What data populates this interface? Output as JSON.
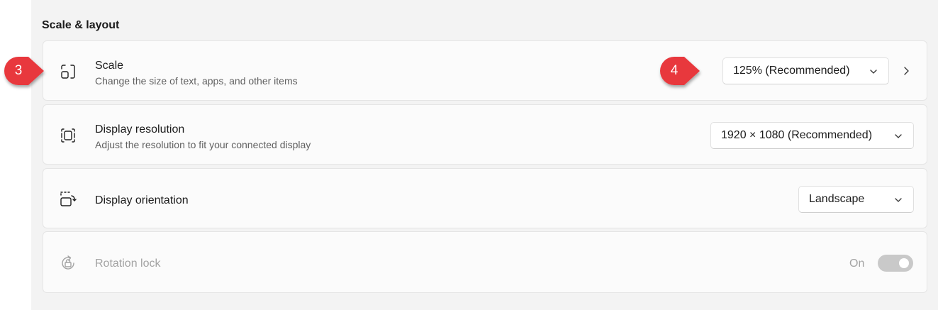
{
  "section": {
    "title": "Scale & layout"
  },
  "scale": {
    "title": "Scale",
    "description": "Change the size of text, apps, and other items",
    "value": "125% (Recommended)",
    "icon": "scale-icon"
  },
  "resolution": {
    "title": "Display resolution",
    "description": "Adjust the resolution to fit your connected display",
    "value": "1920 × 1080 (Recommended)",
    "icon": "resolution-icon"
  },
  "orientation": {
    "title": "Display orientation",
    "value": "Landscape",
    "icon": "orientation-icon"
  },
  "rotation_lock": {
    "title": "Rotation lock",
    "state_label": "On",
    "enabled": false,
    "icon": "rotation-lock-icon"
  },
  "callouts": [
    {
      "label": "3",
      "color": "#e8373d"
    },
    {
      "label": "4",
      "color": "#e8373d"
    }
  ]
}
